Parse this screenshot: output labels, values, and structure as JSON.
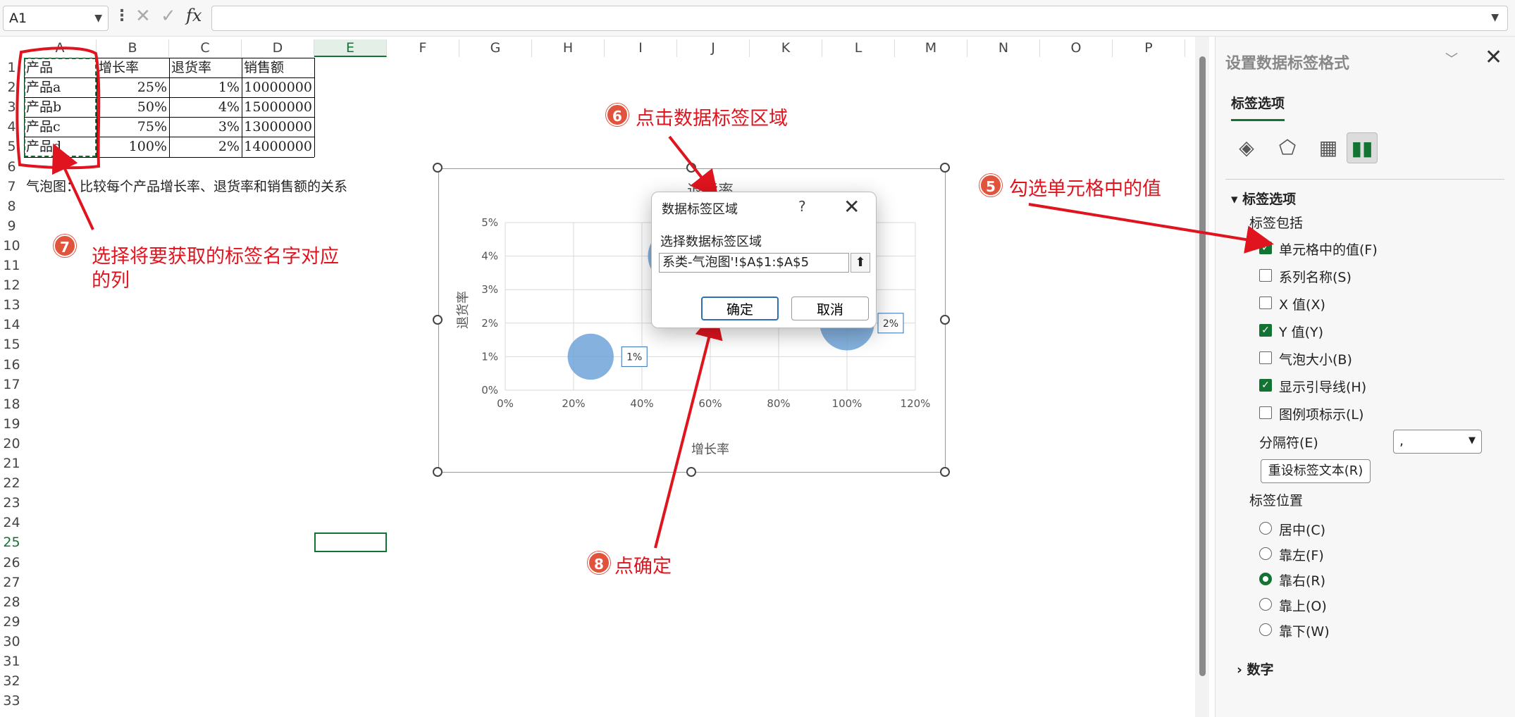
{
  "name_box": "A1",
  "formula_bar": {
    "fx": "fx",
    "value": ""
  },
  "columns": [
    "A",
    "B",
    "C",
    "D",
    "E",
    "F",
    "G",
    "H",
    "I",
    "J",
    "K",
    "L",
    "M",
    "N",
    "O",
    "P"
  ],
  "rows": [
    "1",
    "2",
    "3",
    "4",
    "5",
    "6",
    "7",
    "8",
    "9",
    "10",
    "11",
    "12",
    "13",
    "14",
    "15",
    "16",
    "17",
    "18",
    "19",
    "20",
    "21",
    "22",
    "23",
    "24",
    "25",
    "26",
    "27",
    "28",
    "29",
    "30",
    "31",
    "32",
    "33"
  ],
  "table": {
    "headers": [
      "产品",
      "增长率",
      "退货率",
      "销售额"
    ],
    "rows": [
      [
        "产品a",
        "25%",
        "1%",
        "10000000"
      ],
      [
        "产品b",
        "50%",
        "4%",
        "15000000"
      ],
      [
        "产品c",
        "75%",
        "3%",
        "13000000"
      ],
      [
        "产品d",
        "100%",
        "2%",
        "14000000"
      ]
    ]
  },
  "note": "气泡图：比较每个产品增长率、退货率和销售额的关系",
  "chart_data": {
    "type": "scatter",
    "title": "退货率",
    "xlabel": "增长率",
    "ylabel": "退货率",
    "xlim": [
      0,
      1.2
    ],
    "ylim": [
      0,
      0.05
    ],
    "x_ticks": [
      "0%",
      "20%",
      "40%",
      "60%",
      "80%",
      "100%",
      "120%"
    ],
    "y_ticks": [
      "0%",
      "1%",
      "2%",
      "3%",
      "4%",
      "5%"
    ],
    "points": [
      {
        "x": 0.25,
        "y": 0.01,
        "size": 10000000,
        "label": "1%"
      },
      {
        "x": 0.5,
        "y": 0.04,
        "size": 15000000,
        "label": ""
      },
      {
        "x": 0.75,
        "y": 0.03,
        "size": 13000000,
        "label": ""
      },
      {
        "x": 1.0,
        "y": 0.02,
        "size": 14000000,
        "label": "2%"
      }
    ],
    "grid": true,
    "bubble_color": "#6fa3d8"
  },
  "dialog": {
    "title": "数据标签区域",
    "help": "?",
    "label": "选择数据标签区域",
    "value": "系类-气泡图'!$A$1:$A$5",
    "ok": "确定",
    "cancel": "取消"
  },
  "panel": {
    "title": "设置数据标签格式",
    "tab": "标签选项",
    "section_label_options": "标签选项",
    "label_includes": "标签包括",
    "checkboxes": [
      {
        "label": "单元格中的值(F)",
        "checked": true
      },
      {
        "label": "系列名称(S)",
        "checked": false
      },
      {
        "label": "X 值(X)",
        "checked": false
      },
      {
        "label": "Y 值(Y)",
        "checked": true
      },
      {
        "label": "气泡大小(B)",
        "checked": false
      },
      {
        "label": "显示引导线(H)",
        "checked": true
      },
      {
        "label": "图例项标示(L)",
        "checked": false
      }
    ],
    "separator_label": "分隔符(E)",
    "separator_value": ",",
    "reset_button": "重设标签文本(R)",
    "label_position": "标签位置",
    "radios": [
      {
        "label": "居中(C)",
        "checked": false
      },
      {
        "label": "靠左(F)",
        "checked": false
      },
      {
        "label": "靠右(R)",
        "checked": true
      },
      {
        "label": "靠上(O)",
        "checked": false
      },
      {
        "label": "靠下(W)",
        "checked": false
      }
    ],
    "number_section": "数字"
  },
  "annotations": {
    "a5": {
      "num": "5",
      "text": "勾选单元格中的值"
    },
    "a6": {
      "num": "6",
      "text": "点击数据标签区域"
    },
    "a7": {
      "num": "7",
      "text1": "选择将要获取的标签名字对应",
      "text2": "的列"
    },
    "a8": {
      "num": "8",
      "text": "点确定"
    }
  },
  "colors": {
    "accent": "#137333",
    "annotation": "#e0141e",
    "circle": "#e0533d"
  }
}
